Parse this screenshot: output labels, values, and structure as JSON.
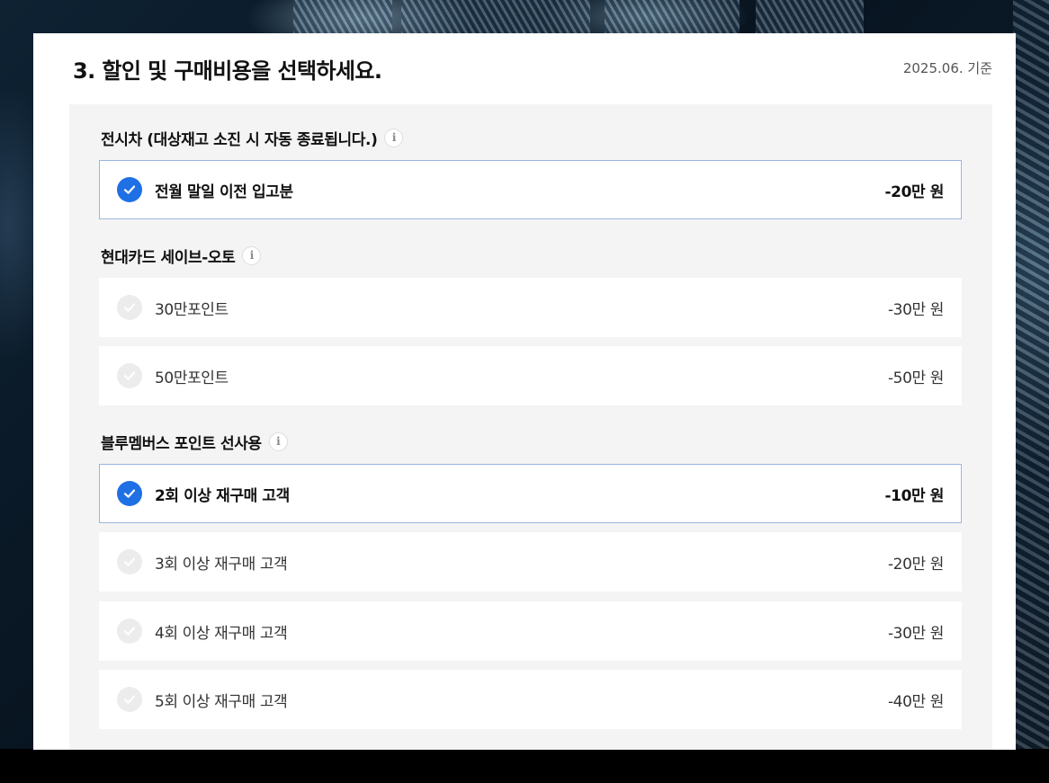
{
  "header": {
    "title": "3. 할인 및 구매비용을 선택하세요.",
    "date_note": "2025.06. 기준"
  },
  "icons": {
    "info": "info-icon",
    "check": "check-icon"
  },
  "colors": {
    "selected_check": "#1f6fe5",
    "selected_border": "#9bb5e3",
    "unselected_check": "#ececec",
    "section_background": "#f4f4f4"
  },
  "sections": [
    {
      "title": "전시차 (대상재고 소진 시 자동 종료됩니다.)",
      "info_glyph": "i",
      "options": [
        {
          "label": "전월 말일 이전 입고분",
          "amount": "-20만 원",
          "selected": true
        }
      ]
    },
    {
      "title": "현대카드 세이브-오토",
      "info_glyph": "i",
      "options": [
        {
          "label": "30만포인트",
          "amount": "-30만 원",
          "selected": false
        },
        {
          "label": "50만포인트",
          "amount": "-50만 원",
          "selected": false
        }
      ]
    },
    {
      "title": "블루멤버스 포인트 선사용",
      "info_glyph": "i",
      "options": [
        {
          "label": "2회 이상 재구매 고객",
          "amount": "-10만 원",
          "selected": true
        },
        {
          "label": "3회 이상 재구매 고객",
          "amount": "-20만 원",
          "selected": false
        },
        {
          "label": "4회 이상 재구매 고객",
          "amount": "-30만 원",
          "selected": false
        },
        {
          "label": "5회 이상 재구매 고객",
          "amount": "-40만 원",
          "selected": false
        }
      ]
    }
  ]
}
